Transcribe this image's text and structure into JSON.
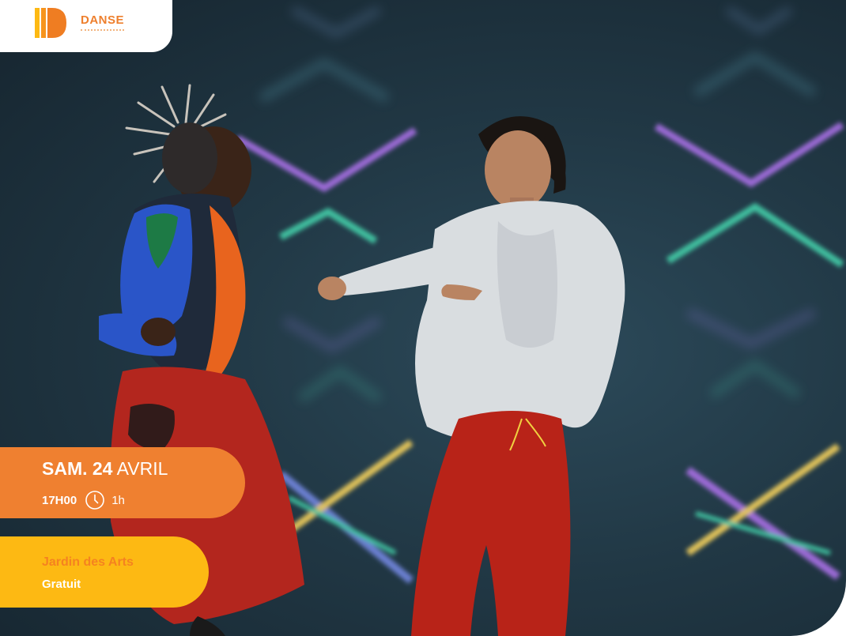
{
  "category": {
    "label": "DANSE",
    "logo_icon": "letter-d-stripes-logo",
    "color": "#ee7f2d"
  },
  "photo": {
    "background_color": "#213845",
    "pattern_colors": [
      "#9b6ad6",
      "#3fbf9f",
      "#e0c25a",
      "#6a7fd0"
    ]
  },
  "event": {
    "day_label": "SAM. 24",
    "month_label": "AVRIL",
    "time": "17H00",
    "time_icon": "clock-icon",
    "duration": "1h",
    "date_pill_color": "#ef8030"
  },
  "venue": {
    "name": "Jardin des Arts",
    "price": "Gratuit",
    "pill_color": "#fdb913",
    "name_color": "#f58220"
  }
}
